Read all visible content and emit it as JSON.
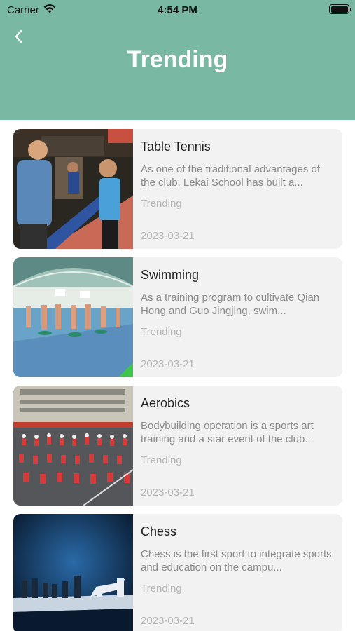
{
  "status_bar": {
    "carrier": "Carrier",
    "time": "4:54 PM"
  },
  "header": {
    "title": "Trending",
    "background": "#79b8a3"
  },
  "items": [
    {
      "title": "Table Tennis",
      "description": "As one of the traditional advantages of the club, Lekai School has built a...",
      "tag": "Trending",
      "date": "2023-03-21"
    },
    {
      "title": "Swimming",
      "description": "As a training program to cultivate Qian Hong and Guo Jingjing, swim...",
      "tag": "Trending",
      "date": "2023-03-21"
    },
    {
      "title": "Aerobics",
      "description": "Bodybuilding operation is a sports art training and a star event of the club...",
      "tag": "Trending",
      "date": "2023-03-21"
    },
    {
      "title": "Chess",
      "description": "Chess is the first sport to integrate sports and education on the campu...",
      "tag": "Trending",
      "date": "2023-03-21"
    }
  ]
}
